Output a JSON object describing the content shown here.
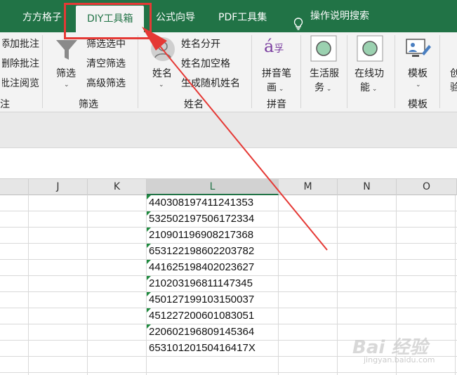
{
  "tabs": [
    {
      "label": "方方格子"
    },
    {
      "label": "DIY工具箱"
    },
    {
      "label": "公式向导"
    },
    {
      "label": "PDF工具集"
    },
    {
      "label": "操作说明搜索"
    }
  ],
  "ribbon": {
    "comment": {
      "items": [
        "添加批注",
        "删除批注",
        "批注阅览"
      ],
      "group_label": "注"
    },
    "filter": {
      "button_label": "筛选",
      "items": [
        "筛选选中",
        "清空筛选",
        "高级筛选"
      ],
      "group_label": "筛选"
    },
    "name": {
      "button_label": "姓名",
      "items": [
        "姓名分开",
        "姓名加空格",
        "生成随机姓名"
      ],
      "group_label": "姓名"
    },
    "pinyin": {
      "button_label_1": "拼音笔",
      "button_label_2": "画",
      "group_label": "拼音"
    },
    "life": {
      "label_1": "生活服",
      "label_2": "务"
    },
    "online": {
      "label_1": "在线功",
      "label_2": "能"
    },
    "template": {
      "button_label": "模板",
      "group_label": "模板"
    },
    "create": {
      "label_1": "创",
      "label_2": "验"
    }
  },
  "columns": [
    "J",
    "K",
    "L",
    "M",
    "N",
    "O"
  ],
  "cells": [
    "440308197411241353",
    "532502197506172334",
    "210901196908217368",
    "653122198602203782",
    "441625198402023627",
    "210203196811147345",
    "450127199103150037",
    "451227200601083051",
    "220602196809145364",
    "65310120150416417X"
  ],
  "watermark": {
    "text": "Bai 经验",
    "sub": "jingyan.baidu.com"
  },
  "colors": {
    "accent": "#217346",
    "highlight": "#e53935",
    "flag": "#1e8a3e"
  }
}
